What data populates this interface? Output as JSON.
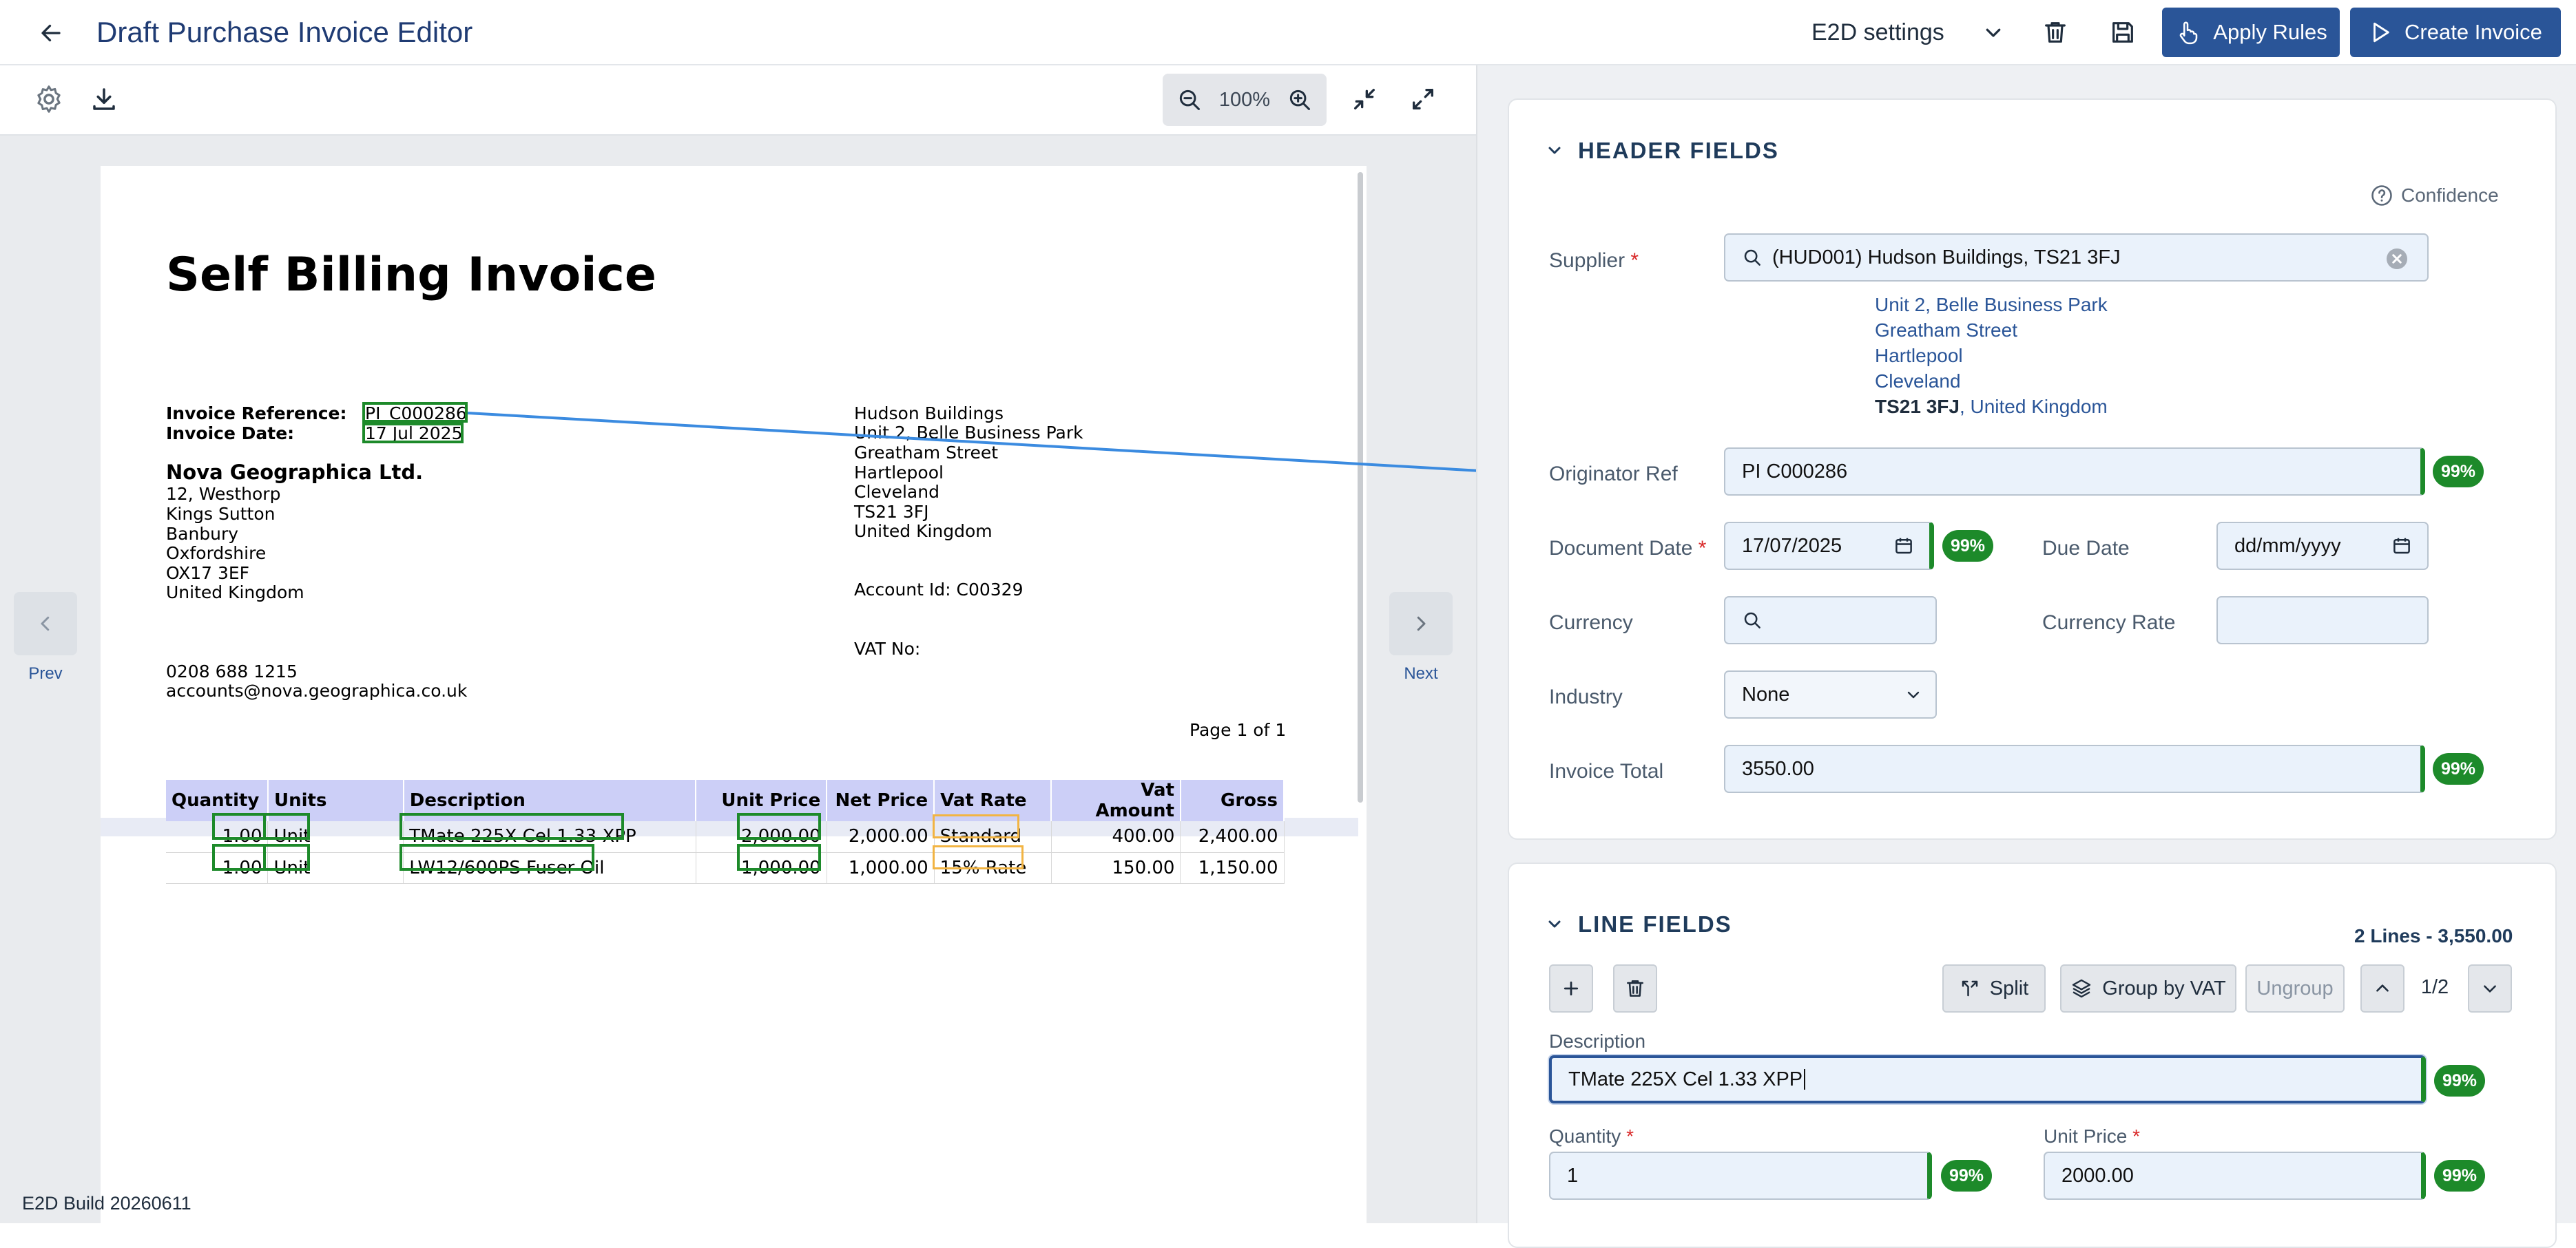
{
  "app": {
    "title": "Draft Purchase Invoice Editor",
    "settings_select": "E2D settings",
    "apply_rules": "Apply Rules",
    "create_invoice": "Create Invoice",
    "accent": "#2a5598"
  },
  "toolbar": {
    "zoom": "100%"
  },
  "nav": {
    "prev": "Prev",
    "next": "Next"
  },
  "build": "E2D Build 20260611",
  "doc": {
    "title": "Self Billing Invoice",
    "ref_label": "Invoice Reference:",
    "ref_value": "PI_C000286",
    "date_label": "Invoice Date:",
    "date_value": "17 Jul 2025",
    "company": "Nova Geographica Ltd.",
    "company_address": [
      "12, Westhorp",
      "Kings Sutton",
      "Banbury",
      "Oxfordshire",
      "OX17 3EF",
      "United Kingdom"
    ],
    "phone": "0208 688 1215",
    "email": "accounts@nova.geographica.co.uk",
    "supplier_address": [
      "Hudson Buildings",
      "Unit 2, Belle Business Park",
      "Greatham Street",
      "Hartlepool",
      "Cleveland",
      "TS21 3FJ",
      "United Kingdom"
    ],
    "account_id": "Account Id:  C00329",
    "vat_no": "VAT No:",
    "page": "Page 1 of 1",
    "table": {
      "headers": [
        "Quantity",
        "Units",
        "Description",
        "Unit Price",
        "Net Price",
        "Vat Rate",
        "Vat Amount",
        "Gross"
      ],
      "rows": [
        [
          "1.00",
          "Unit",
          "TMate 225X Cel 1.33 XPP",
          "2,000.00",
          "2,000.00",
          "Standard",
          "400.00",
          "2,400.00"
        ],
        [
          "1.00",
          "Unit",
          "LW12/600PS Fuser Oil",
          "1,000.00",
          "1,000.00",
          "15% Rate",
          "150.00",
          "1,150.00"
        ]
      ]
    }
  },
  "header_fields": {
    "title": "HEADER FIELDS",
    "confidence": "Confidence",
    "supplier_label": "Supplier",
    "supplier_value": "(HUD001) Hudson Buildings, TS21 3FJ",
    "supplier_address": [
      "Unit 2, Belle Business Park",
      "Greatham Street",
      "Hartlepool",
      "Cleveland"
    ],
    "supplier_postcode": "TS21 3FJ",
    "supplier_country": ", United Kingdom",
    "originator_label": "Originator Ref",
    "originator_value": "PI C000286",
    "document_date_label": "Document Date",
    "document_date_value": "17/07/2025",
    "due_date_label": "Due Date",
    "due_date_placeholder": "dd/mm/yyyy",
    "currency_label": "Currency",
    "currency_rate_label": "Currency Rate",
    "industry_label": "Industry",
    "industry_value": "None",
    "invoice_total_label": "Invoice Total",
    "invoice_total_value": "3550.00",
    "conf": "99%"
  },
  "line_fields": {
    "title": "LINE FIELDS",
    "summary": "2 Lines - 3,550.00",
    "split": "Split",
    "group_by_vat": "Group by VAT",
    "ungroup": "Ungroup",
    "pager": "1/2",
    "description_label": "Description",
    "description_value": "TMate 225X Cel 1.33 XPP",
    "quantity_label": "Quantity",
    "quantity_value": "1",
    "unit_price_label": "Unit Price",
    "unit_price_value": "2000.00",
    "conf": "99%"
  }
}
